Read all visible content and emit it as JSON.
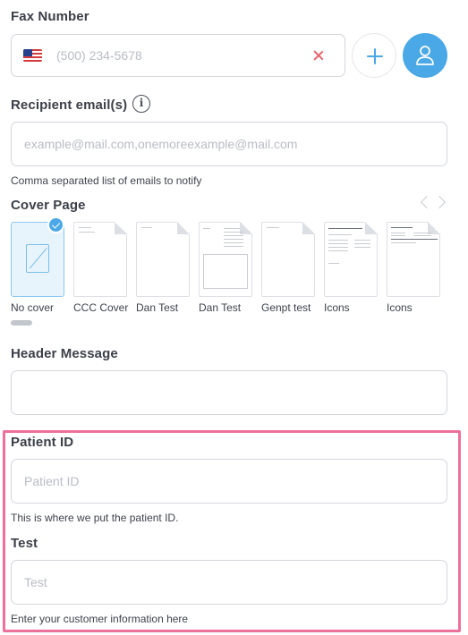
{
  "fax": {
    "label": "Fax Number",
    "placeholder": "(500) 234-5678",
    "flag": "us-flag",
    "clear_icon": "close-icon",
    "add_icon": "plus-icon",
    "contact_icon": "user-icon"
  },
  "recipient": {
    "label": "Recipient email(s)",
    "info_icon": "i",
    "placeholder": "example@mail.com,onemoreexample@mail.com",
    "helper": "Comma separated list of emails to notify"
  },
  "cover": {
    "label": "Cover Page",
    "items": [
      {
        "name": "No cover",
        "selected": true
      },
      {
        "name": "CCC Cover",
        "selected": false
      },
      {
        "name": "Dan Test",
        "selected": false
      },
      {
        "name": "Dan Test",
        "selected": false
      },
      {
        "name": "Genpt test",
        "selected": false
      },
      {
        "name": "Icons",
        "selected": false
      },
      {
        "name": "Icons",
        "selected": false
      }
    ]
  },
  "header_message": {
    "label": "Header Message",
    "value": ""
  },
  "patient_id": {
    "label": "Patient ID",
    "placeholder": "Patient ID",
    "helper": "This is where we put the patient ID."
  },
  "test": {
    "label": "Test",
    "placeholder": "Test",
    "helper": "Enter your customer information here"
  },
  "colors": {
    "accent": "#4aa8e6",
    "highlight": "#ee6f99",
    "clear": "#e5676f"
  }
}
